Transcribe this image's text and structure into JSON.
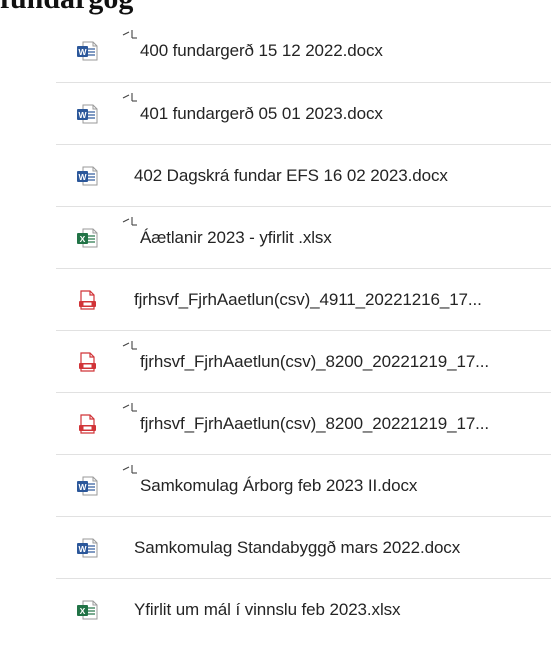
{
  "page": {
    "title": "fundargog"
  },
  "colors": {
    "word": "#2b579a",
    "excel": "#217346",
    "pdf": "#d13438",
    "text": "#242424",
    "divider": "#e1e1e1"
  },
  "files": [
    {
      "name": "400 fundargerð 15 12 2022.docx",
      "type": "word",
      "icon": "word-file-icon",
      "new": true
    },
    {
      "name": "401 fundargerð 05 01 2023.docx",
      "type": "word",
      "icon": "word-file-icon",
      "new": true
    },
    {
      "name": "402 Dagskrá fundar EFS 16 02 2023.docx",
      "type": "word",
      "icon": "word-file-icon",
      "new": false
    },
    {
      "name": "Áætlanir 2023 - yfirlit .xlsx",
      "type": "excel",
      "icon": "excel-file-icon",
      "new": true
    },
    {
      "name": "fjrhsvf_FjrhAaetlun(csv)_4911_20221216_17...",
      "type": "pdf",
      "icon": "pdf-file-icon",
      "new": false
    },
    {
      "name": "fjrhsvf_FjrhAaetlun(csv)_8200_20221219_17...",
      "type": "pdf",
      "icon": "pdf-file-icon",
      "new": true
    },
    {
      "name": "fjrhsvf_FjrhAaetlun(csv)_8200_20221219_17...",
      "type": "pdf",
      "icon": "pdf-file-icon",
      "new": true
    },
    {
      "name": "Samkomulag Árborg feb 2023 II.docx",
      "type": "word",
      "icon": "word-file-icon",
      "new": true
    },
    {
      "name": "Samkomulag Standabyggð mars 2022.docx",
      "type": "word",
      "icon": "word-file-icon",
      "new": false
    },
    {
      "name": "Yfirlit um mál í vinnslu feb 2023.xlsx",
      "type": "excel",
      "icon": "excel-file-icon",
      "new": false
    }
  ]
}
